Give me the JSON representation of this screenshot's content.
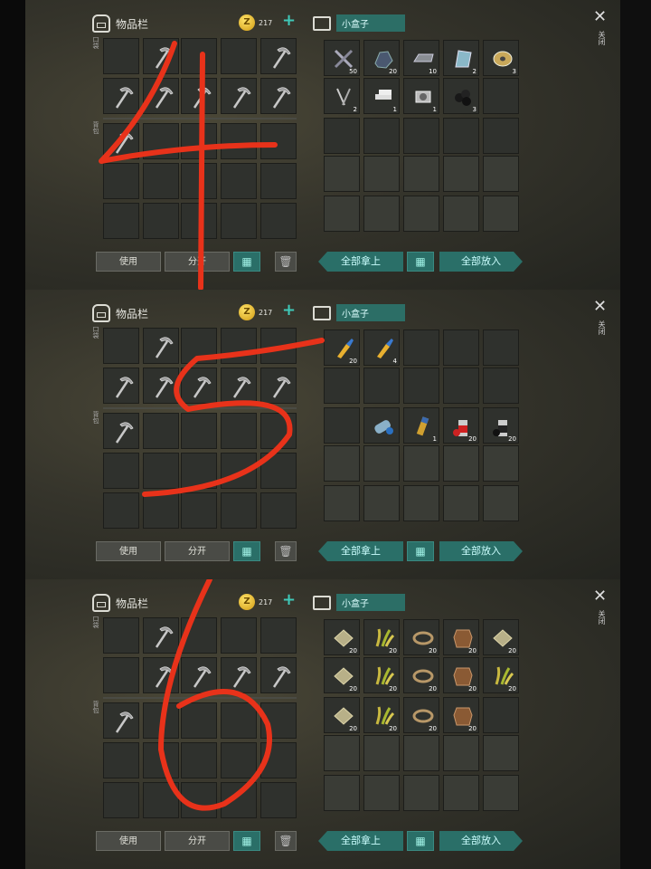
{
  "panels": [
    {
      "number": "4",
      "inventory": {
        "title": "物品栏",
        "coins": "217",
        "hotbar_label": "口袋",
        "backpack_label": "背包",
        "buttons": {
          "use": "使用",
          "split": "分开"
        }
      },
      "box": {
        "title": "小盒子",
        "close_label": "关闭",
        "buttons": {
          "take_all": "全部拿上",
          "put_all": "全部放入"
        },
        "items": [
          {
            "name": "crossed-metal-icon",
            "qty": "50"
          },
          {
            "name": "ore-icon",
            "qty": "20"
          },
          {
            "name": "metal-ingot-icon",
            "qty": "10"
          },
          {
            "name": "glass-icon",
            "qty": "2"
          },
          {
            "name": "wire-spool-icon",
            "qty": "3"
          },
          {
            "name": "nails-icon",
            "qty": "2"
          },
          {
            "name": "metal-bars-icon",
            "qty": "1"
          },
          {
            "name": "engine-part-icon",
            "qty": "1"
          },
          {
            "name": "coal-icon",
            "qty": "3"
          }
        ]
      }
    },
    {
      "number": "5",
      "inventory": {
        "title": "物品栏",
        "coins": "217",
        "hotbar_label": "口袋",
        "backpack_label": "背包",
        "buttons": {
          "use": "使用",
          "split": "分开"
        }
      },
      "box": {
        "title": "小盒子",
        "close_label": "关闭",
        "buttons": {
          "take_all": "全部拿上",
          "put_all": "全部放入"
        },
        "items": [
          {
            "name": "glue-tube-icon",
            "qty": "20"
          },
          {
            "name": "glue-tube-icon",
            "qty": "4"
          },
          {
            "name": "blueprint-icon",
            "qty": ""
          },
          {
            "name": "battery-icon",
            "qty": "1"
          },
          {
            "name": "red-spray-can-icon",
            "qty": "20"
          },
          {
            "name": "black-spray-can-icon",
            "qty": "20"
          }
        ]
      }
    },
    {
      "number": "6",
      "inventory": {
        "title": "物品栏",
        "coins": "217",
        "hotbar_label": "口袋",
        "backpack_label": "背包",
        "buttons": {
          "use": "使用",
          "split": "分开"
        }
      },
      "box": {
        "title": "小盒子",
        "close_label": "关闭",
        "buttons": {
          "take_all": "全部拿上",
          "put_all": "全部放入"
        },
        "items": [
          {
            "name": "cloth-icon",
            "qty": "20"
          },
          {
            "name": "plant-fiber-icon",
            "qty": "20"
          },
          {
            "name": "rope-icon",
            "qty": "20"
          },
          {
            "name": "leather-icon",
            "qty": "20"
          },
          {
            "name": "cloth-icon",
            "qty": "20"
          },
          {
            "name": "cloth-icon",
            "qty": "20"
          },
          {
            "name": "plant-fiber-icon",
            "qty": "20"
          },
          {
            "name": "rope-icon",
            "qty": "20"
          },
          {
            "name": "leather-icon",
            "qty": "20"
          },
          {
            "name": "plant-fiber-icon",
            "qty": "20"
          },
          {
            "name": "cloth-icon",
            "qty": "20"
          },
          {
            "name": "plant-fiber-icon",
            "qty": "20"
          },
          {
            "name": "rope-icon",
            "qty": "20"
          },
          {
            "name": "leather-icon",
            "qty": "20"
          }
        ]
      }
    }
  ],
  "colors": {
    "accent": "#2a6f68",
    "scribble": "#e8321a",
    "coin": "#f0c030"
  }
}
